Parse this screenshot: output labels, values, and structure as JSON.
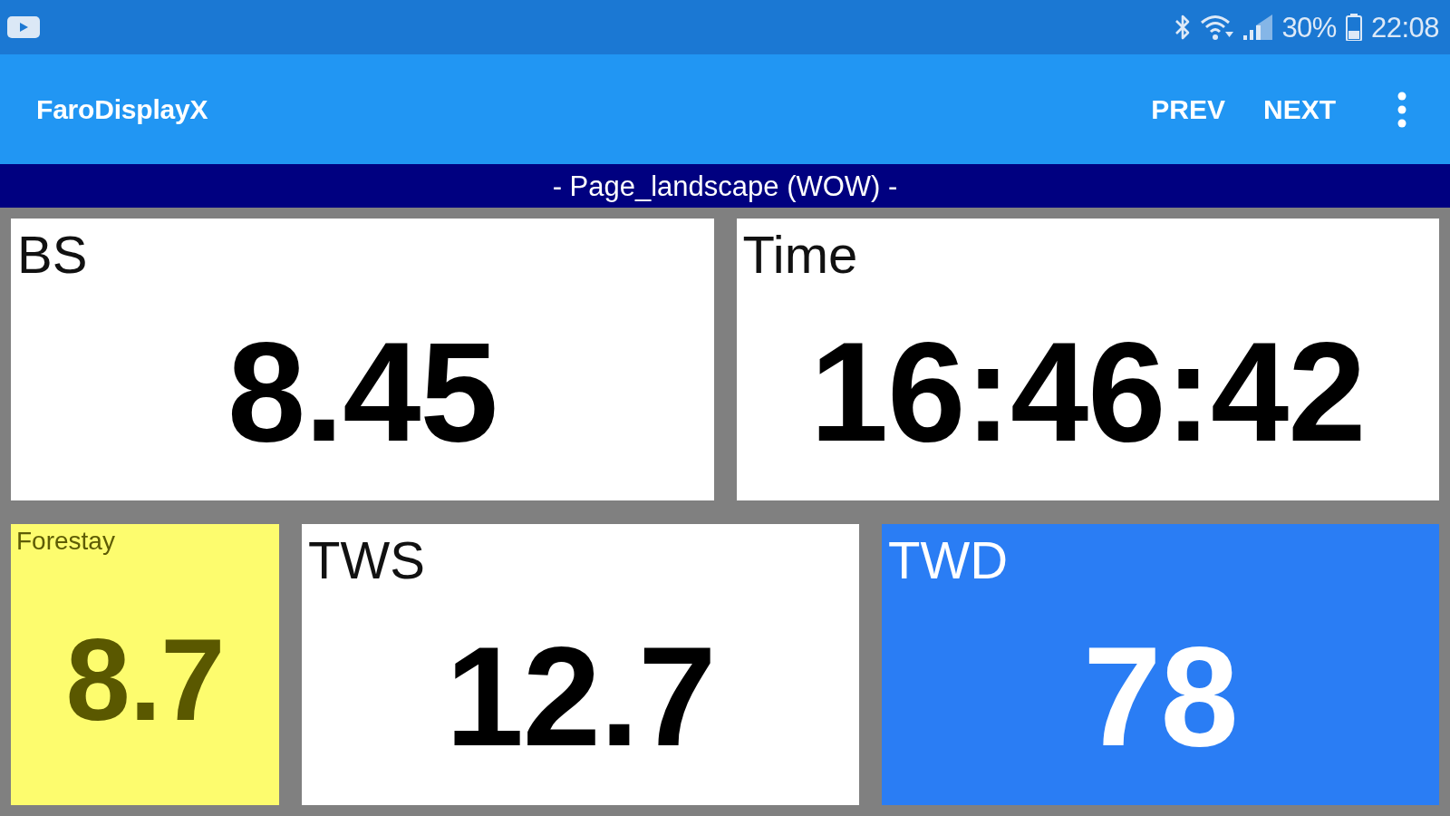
{
  "status_bar": {
    "battery": "30%",
    "time": "22:08"
  },
  "app_bar": {
    "title": "FaroDisplayX",
    "actions": [
      "PREV",
      "NEXT"
    ]
  },
  "page_title": "- Page_landscape (WOW) -",
  "rows": [
    {
      "tiles": [
        {
          "label": "BS",
          "value": "8.45",
          "kind": "plain"
        },
        {
          "label": "Time",
          "value": "16:46:42",
          "kind": "plain"
        }
      ]
    },
    {
      "tiles": [
        {
          "label": "Forestay",
          "value": "8.7",
          "kind": "warning"
        },
        {
          "label": "TWS",
          "value": "12.7",
          "kind": "plain"
        },
        {
          "label": "TWD",
          "value": "78",
          "kind": "highlight"
        }
      ]
    }
  ]
}
